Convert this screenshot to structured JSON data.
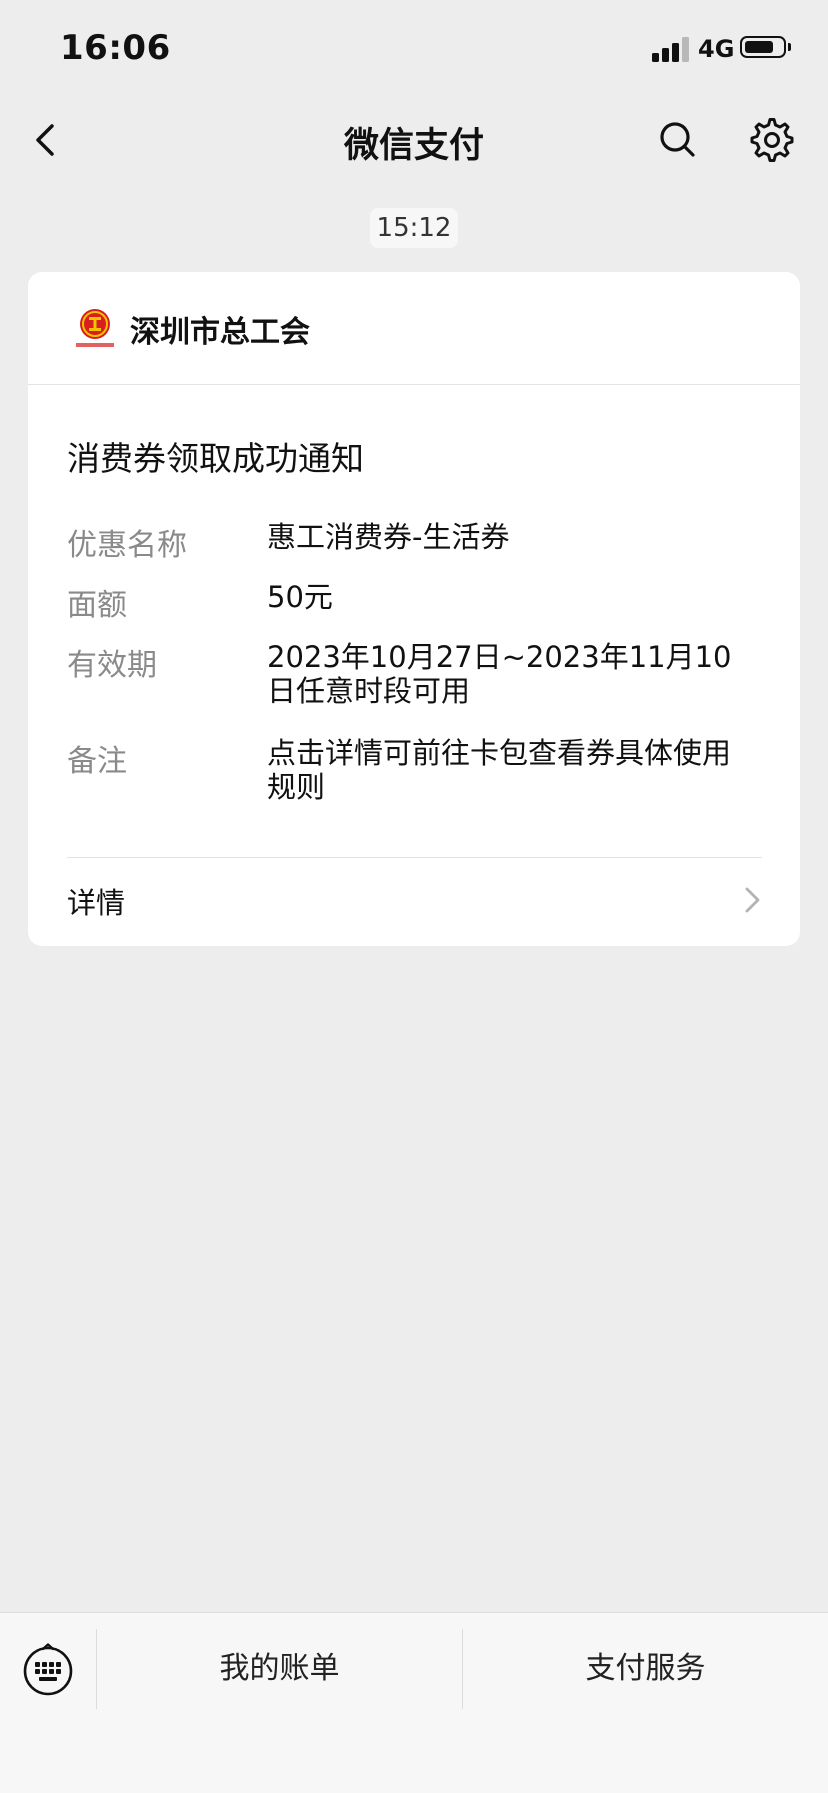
{
  "status_bar": {
    "time": "16:06",
    "network": "4G",
    "battery_level": 0.78
  },
  "nav": {
    "title": "微信支付",
    "icons": [
      "back-icon",
      "search-icon",
      "gear-icon"
    ]
  },
  "message": {
    "time": "15:12",
    "org_name": "深圳市总工会",
    "title": "消费券领取成功通知",
    "fields": [
      {
        "label": "优惠名称",
        "value": "惠工消费券-生活券"
      },
      {
        "label": "面额",
        "value": "50元"
      },
      {
        "label": "有效期",
        "value": "2023年10月27日~2023年11月10日任意时段可用"
      },
      {
        "label": "备注",
        "value": "点击详情可前往卡包查看券具体使用规则"
      }
    ],
    "detail_label": "详情"
  },
  "bottom_menu": {
    "items": [
      "我的账单",
      "支付服务"
    ],
    "icons": [
      "keyboard-icon"
    ]
  },
  "colors": {
    "background": "#ededed",
    "card": "#ffffff",
    "logo_red": "#d81e1e",
    "logo_gold": "#f2c200"
  }
}
